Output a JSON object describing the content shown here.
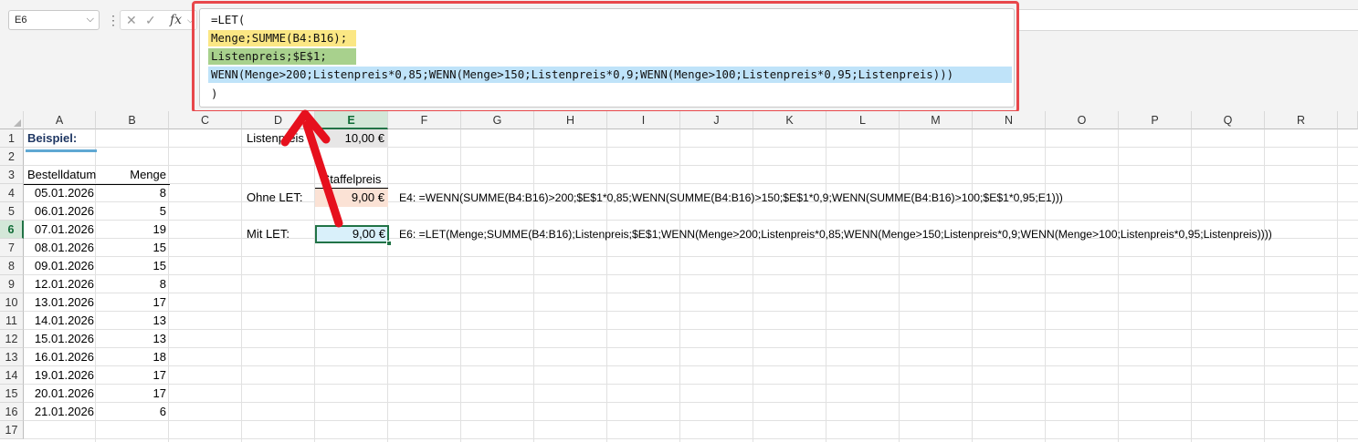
{
  "formula_bar": {
    "name_box": "E6",
    "name_box_icon": "chevron-down-icon",
    "separator_icon": "vertical-dots-icon",
    "cancel_icon": "cancel-x-icon",
    "confirm_icon": "checkmark-icon",
    "fx_label": "fx",
    "lines": [
      "=LET(",
      "Menge;SUMME(B4:B16);",
      "Listenpreis;$E$1;",
      "WENN(Menge>200;Listenpreis*0,85;WENN(Menge>150;Listenpreis*0,9;WENN(Menge>100;Listenpreis*0,95;Listenpreis)))",
      ")"
    ],
    "highlight_colors": [
      "#fbe784",
      "#a8d18d",
      "#bfe3f9"
    ],
    "outline_color": "#e8474b"
  },
  "columns": [
    "A",
    "B",
    "C",
    "D",
    "E",
    "F",
    "G",
    "H",
    "I",
    "J",
    "K",
    "L",
    "M",
    "N",
    "O",
    "P",
    "Q",
    "R"
  ],
  "selected_column": "E",
  "rows": [
    "1",
    "2",
    "3",
    "4",
    "5",
    "6",
    "7",
    "8",
    "9",
    "10",
    "11",
    "12",
    "13",
    "14",
    "15",
    "16",
    "17"
  ],
  "selected_row": "6",
  "sheet": {
    "title": "Beispiel:",
    "header_date": "Bestelldatum",
    "header_qty": "Menge",
    "orders": [
      {
        "date": "05.01.2026",
        "qty": "8"
      },
      {
        "date": "06.01.2026",
        "qty": "5"
      },
      {
        "date": "07.01.2026",
        "qty": "19"
      },
      {
        "date": "08.01.2026",
        "qty": "15"
      },
      {
        "date": "09.01.2026",
        "qty": "15"
      },
      {
        "date": "12.01.2026",
        "qty": "8"
      },
      {
        "date": "13.01.2026",
        "qty": "17"
      },
      {
        "date": "14.01.2026",
        "qty": "13"
      },
      {
        "date": "15.01.2026",
        "qty": "13"
      },
      {
        "date": "16.01.2026",
        "qty": "18"
      },
      {
        "date": "19.01.2026",
        "qty": "17"
      },
      {
        "date": "20.01.2026",
        "qty": "17"
      },
      {
        "date": "21.01.2026",
        "qty": "6"
      }
    ],
    "list_price_label": "Listenpreis",
    "list_price_value": "10,00 €",
    "tier_header": "Staffelpreis",
    "without_let_label": "Ohne LET:",
    "without_let_value": "9,00 €",
    "without_let_formula": "E4: =WENN(SUMME(B4:B16)>200;$E$1*0,85;WENN(SUMME(B4:B16)>150;$E$1*0,9;WENN(SUMME(B4:B16)>100;$E$1*0,95;E1)))",
    "with_let_label": "Mit LET:",
    "with_let_value": "9,00 €",
    "with_let_formula": "E6: =LET(Menge;SUMME(B4:B16);Listenpreis;$E$1;WENN(Menge>200;Listenpreis*0,85;WENN(Menge>150;Listenpreis*0,9;WENN(Menge>100;Listenpreis*0,95;Listenpreis))))"
  },
  "annotation": {
    "arrow_icon": "arrow-up-icon",
    "color": "#e6101d"
  }
}
